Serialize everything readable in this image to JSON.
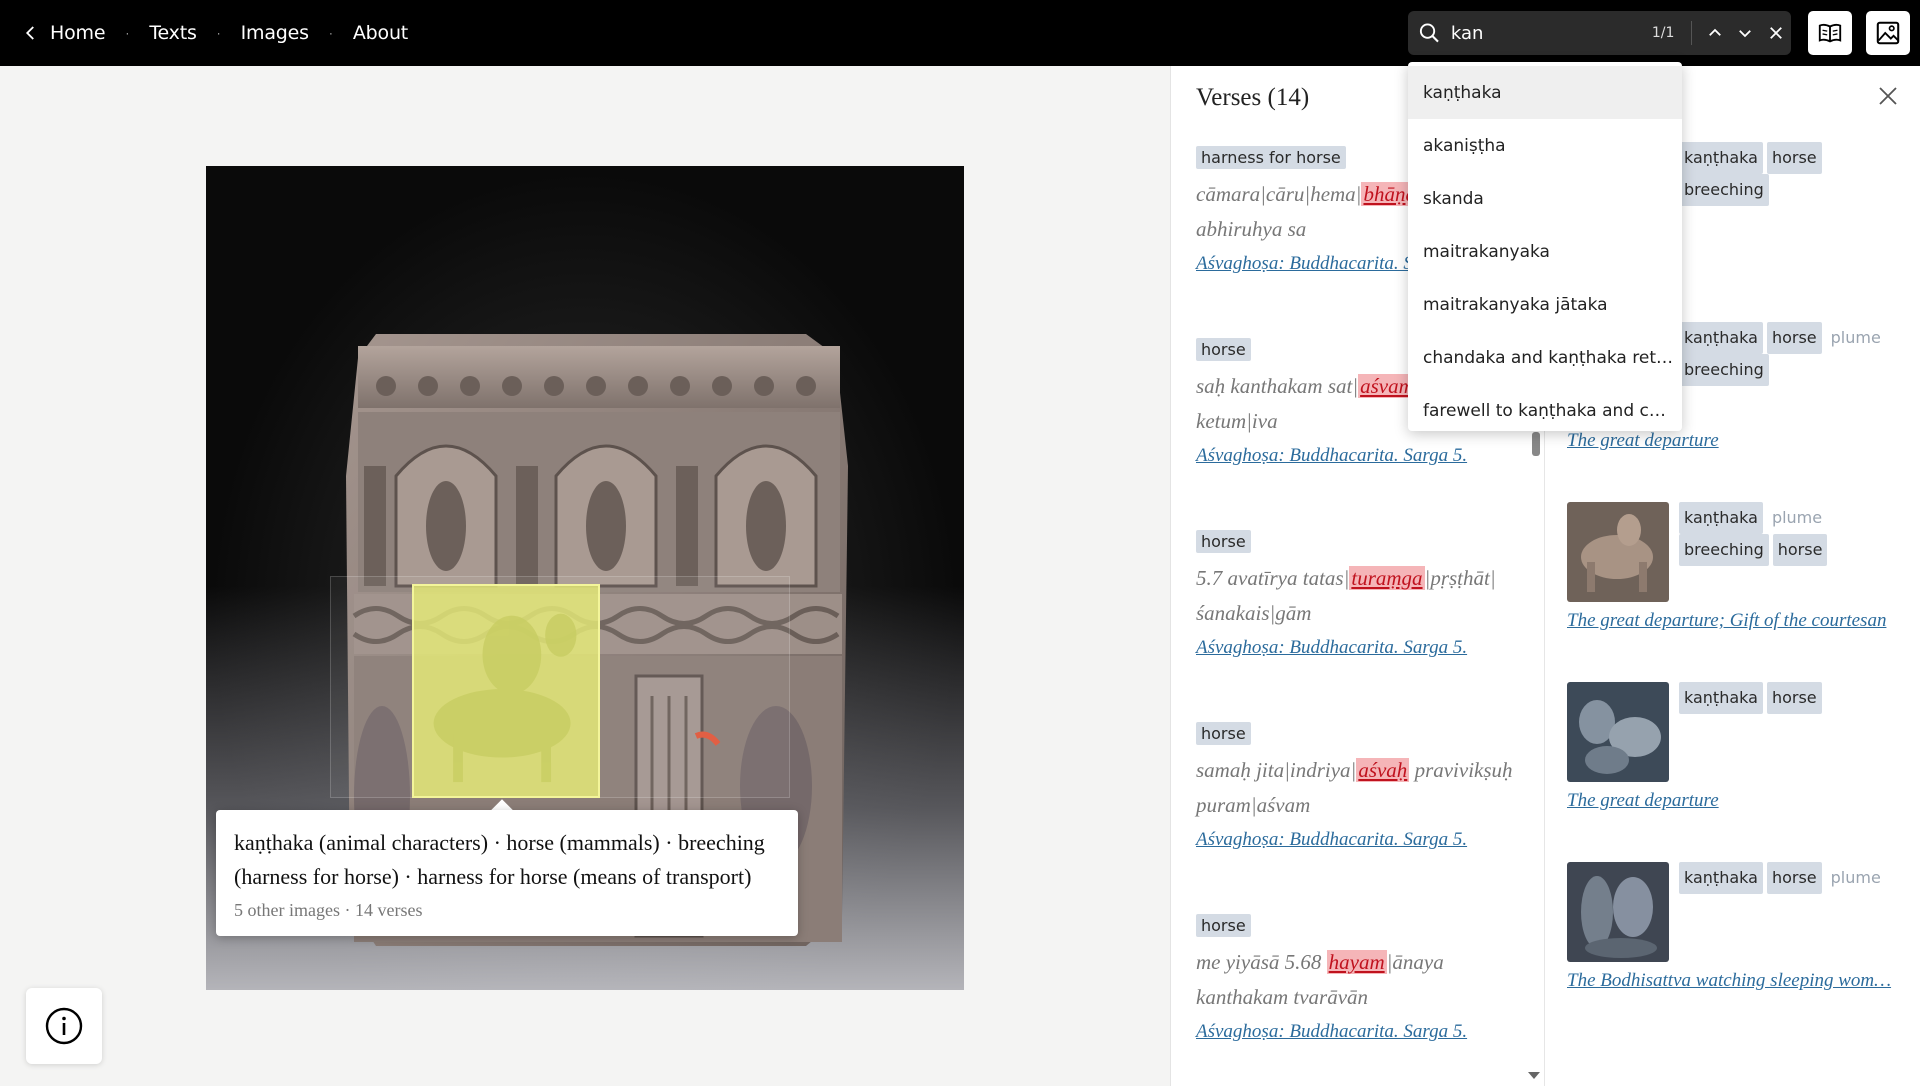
{
  "nav": {
    "home": "Home",
    "texts": "Texts",
    "images": "Images",
    "about": "About",
    "separator": "·"
  },
  "search": {
    "value": "kan",
    "count": "1/1"
  },
  "dropdown": {
    "items": [
      "kaṇṭhaka",
      "akaniṣṭha",
      "skanda",
      "maitrakanyaka",
      "maitrakanyaka jātaka",
      "chandaka and kaṇṭhaka return",
      "farewell to kaṇṭhaka and caṇ…"
    ]
  },
  "tooltip": {
    "main": "kaṇṭhaka (animal characters) · horse (mammals) · breeching (harness for horse) · harness for horse (means of transport)",
    "sub": "5 other images · 14 verses"
  },
  "verses": {
    "title": "Verses (14)",
    "items": [
      {
        "tag": "harness for horse",
        "line1_pre": "cāmara|cāru|hema|",
        "line1_hl": "bhāṇḍar",
        "line1_post": "",
        "line2": "abhiruhya sa",
        "source": "Aśvaghoṣa: Buddhacarita. Sa"
      },
      {
        "tag": "horse",
        "line1_pre": "saḥ kanthakam sat|",
        "line1_hl": "aśvam",
        "line1_post": "",
        "line2": "ketum|iva",
        "source": "Aśvaghoṣa: Buddhacarita. Sarga 5."
      },
      {
        "tag": "horse",
        "line1_pre": "5.7 avatīrya tatas|",
        "line1_hl": "turaṃga",
        "line1_post": "|pṛṣṭhāt|",
        "line2": "śanakais|gām",
        "source": "Aśvaghoṣa: Buddhacarita. Sarga 5."
      },
      {
        "tag": "horse",
        "line1_pre": "samaḥ jita|indriya|",
        "line1_hl": "aśvaḥ",
        "line1_post": " pravivikṣuḥ",
        "line2": "puram|aśvam",
        "source": "Aśvaghoṣa: Buddhacarita. Sarga 5."
      },
      {
        "tag": "horse",
        "line1_pre": "me yiyāsā 5.68 ",
        "line1_hl": "hayam",
        "line1_post": "|ānaya",
        "line2": "kanthakam tvarāvān",
        "source": "Aśvaghoṣa: Buddhacarita. Sarga 5."
      }
    ]
  },
  "images": {
    "items": [
      {
        "tags": [
          "kaṇṭhaka",
          "horse",
          "breeching"
        ],
        "light_tags": [],
        "title": "ture"
      },
      {
        "tags": [
          "kaṇṭhaka",
          "horse"
        ],
        "light_tags": [
          "plume"
        ],
        "tags2": [
          "breeching"
        ],
        "title": "The great departure"
      },
      {
        "tags": [
          "kaṇṭhaka"
        ],
        "light_tags": [
          "plume"
        ],
        "tags2": [
          "breeching",
          "horse"
        ],
        "title": "The great departure; Gift of the courtesan"
      },
      {
        "tags": [
          "kaṇṭhaka",
          "horse"
        ],
        "light_tags": [],
        "title": "The great departure"
      },
      {
        "tags": [
          "kaṇṭhaka",
          "horse"
        ],
        "light_tags": [
          "plume"
        ],
        "title": "The Bodhisattva watching sleeping wom…"
      }
    ]
  },
  "colors": {
    "topbar": "#000000",
    "highlight": "#e6ec78",
    "verse_highlight": "#f5b5b8",
    "link": "#2b6b9c",
    "tag": "#d4dbe4"
  },
  "icons": {
    "back": "chevron-left-icon",
    "search": "search-icon",
    "prev": "chevron-up-icon",
    "next": "chevron-down-icon",
    "clear": "close-icon",
    "book": "book-icon",
    "image": "image-icon",
    "info": "info-icon",
    "panel_close": "close-icon"
  }
}
